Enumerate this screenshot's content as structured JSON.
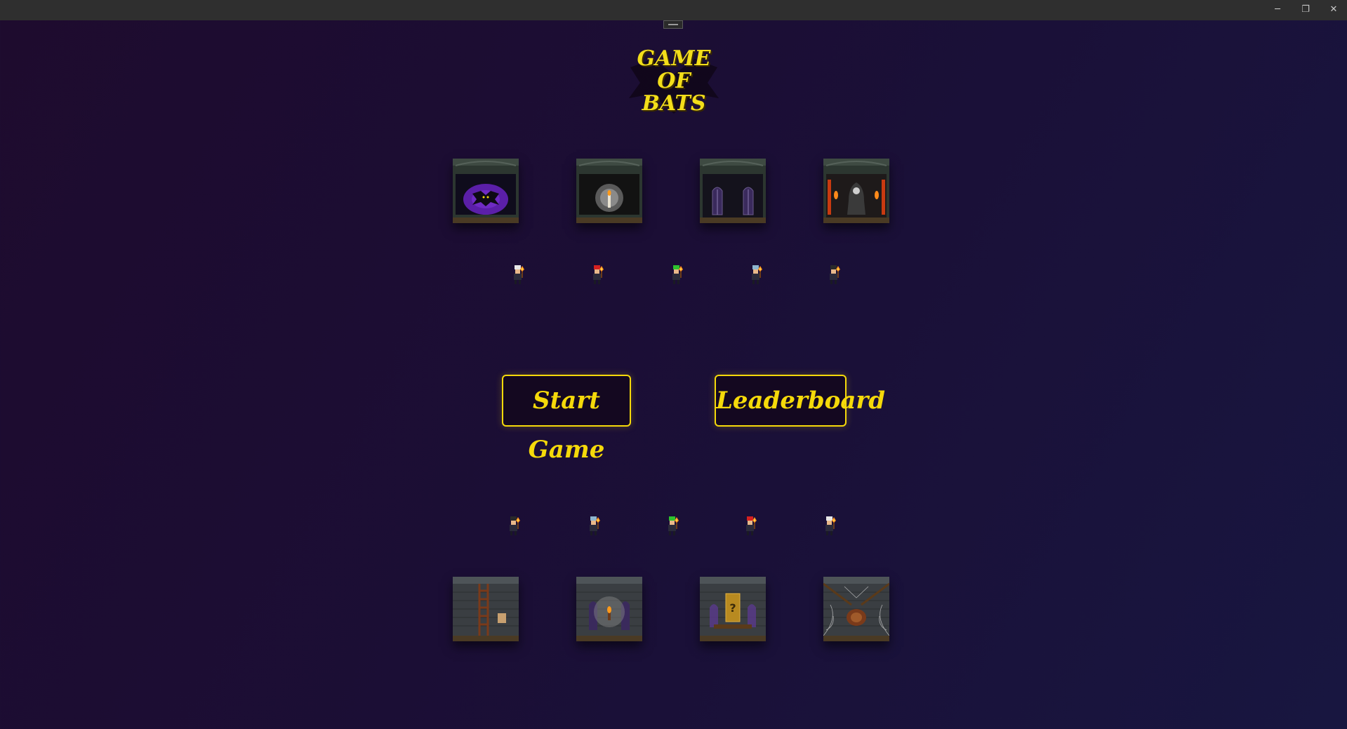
{
  "window": {
    "minimize_icon": "minimize-icon",
    "restore_icon": "restore-icon",
    "close_icon": "close-icon",
    "minimize_glyph": "─",
    "restore_glyph": "❐",
    "close_glyph": "✕"
  },
  "title": {
    "logo_text": "GAME\nOF\nBATS",
    "color": "#f3de1a"
  },
  "menu": {
    "start_label": "Start Game",
    "leaderboard_label": "Leaderboard",
    "accent": "#f5d90a"
  },
  "top_rooms": [
    {
      "name": "bat-room",
      "icon": "bat-icon"
    },
    {
      "name": "candle-room",
      "icon": "candle-icon"
    },
    {
      "name": "window-room",
      "icon": "gothic-window-icon"
    },
    {
      "name": "throne-room",
      "icon": "reaper-icon"
    }
  ],
  "bottom_rooms": [
    {
      "name": "ladder-room",
      "icon": "ladder-icon"
    },
    {
      "name": "torch-room",
      "icon": "torch-icon"
    },
    {
      "name": "mystery-door-room",
      "icon": "mystery-door-icon"
    },
    {
      "name": "spider-room",
      "icon": "spider-web-icon"
    }
  ],
  "top_characters": [
    {
      "hair_color": "#e8e8e8"
    },
    {
      "hair_color": "#d42020"
    },
    {
      "hair_color": "#2ec22e"
    },
    {
      "hair_color": "#8fb6cf"
    },
    {
      "hair_color": "#2a2a2a"
    }
  ],
  "bottom_characters": [
    {
      "hair_color": "#2a2a2a"
    },
    {
      "hair_color": "#8fb6cf"
    },
    {
      "hair_color": "#2ec22e"
    },
    {
      "hair_color": "#d42020"
    },
    {
      "hair_color": "#e8e8e8"
    }
  ]
}
